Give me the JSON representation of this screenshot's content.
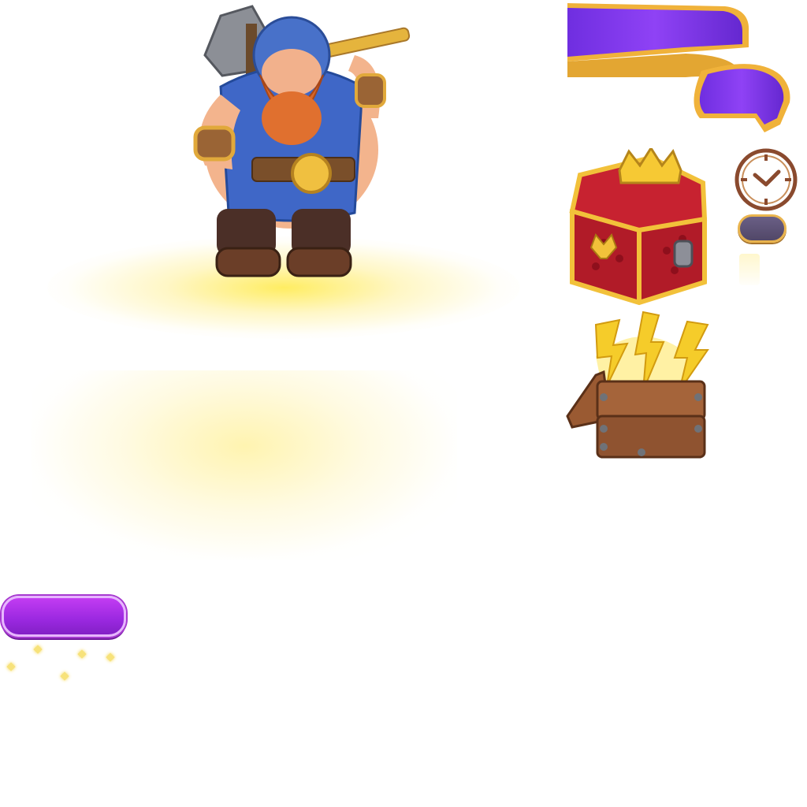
{
  "scene": {
    "character": {
      "icon": "dwarf-warrior-with-axe"
    },
    "ribbon": {
      "icon": "purple-ribbon-banner",
      "color": "#8a3df0",
      "trim_color": "#f0b23a"
    },
    "timer": {
      "icon": "clock-icon",
      "pill_color": "#5e5478",
      "label": ""
    },
    "chests": [
      {
        "icon": "royal-crown-chest"
      },
      {
        "icon": "energy-lightning-crate"
      }
    ],
    "action_button": {
      "label": "",
      "color": "#a52ee6"
    }
  }
}
